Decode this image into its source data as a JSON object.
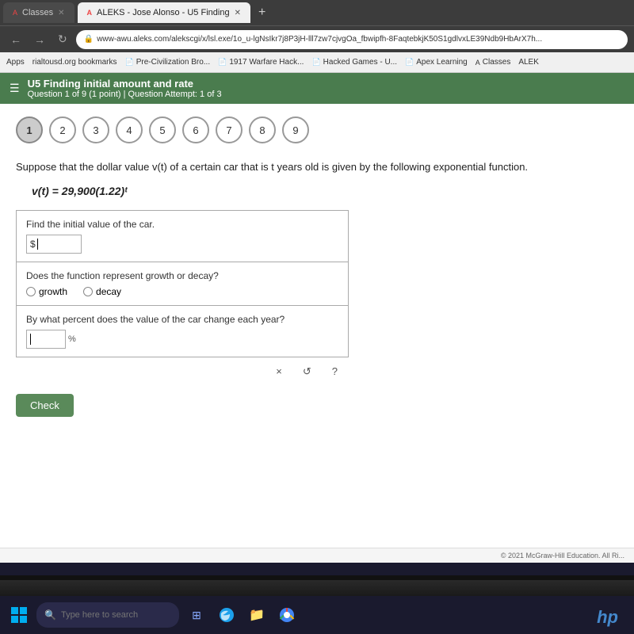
{
  "browser": {
    "tabs": [
      {
        "label": "Classes",
        "active": false
      },
      {
        "label": "ALEKS - Jose Alonso - U5 Finding",
        "active": true
      }
    ],
    "address": "www-awu.aleks.com/alekscgi/x/lsl.exe/1o_u-lgNsIkr7j8P3jH-lll7zw7cjvgOa_fbwipfh-8FaqtebkjK50S1gdlvxLE39Ndb9HbArX7h...",
    "bookmarks": [
      {
        "label": "Apps"
      },
      {
        "label": "rialtousd.org bookmarks"
      },
      {
        "label": "Pre-Civilization Bro..."
      },
      {
        "label": "1917 Warfare Hack..."
      },
      {
        "label": "Hacked Games - U..."
      },
      {
        "label": "Apex Learning"
      },
      {
        "label": "Classes"
      },
      {
        "label": "ALEK"
      }
    ]
  },
  "aleks": {
    "header": {
      "title": "U5 Finding initial amount and rate",
      "subtitle": "Question 1 of 9 (1 point)  |  Question Attempt: 1 of 3"
    },
    "question_numbers": [
      "1",
      "2",
      "3",
      "4",
      "5",
      "6",
      "7",
      "8",
      "9"
    ],
    "active_question": 0,
    "problem_text": "Suppose that the dollar value v(t) of a certain car that is t years old is given by the following exponential function.",
    "formula": "v(t) = 29,900(1.22)ᵗ",
    "questions": [
      {
        "label": "Find the initial value of the car.",
        "input_prefix": "$",
        "type": "text_input"
      },
      {
        "label": "Does the function represent growth or decay?",
        "type": "radio",
        "options": [
          "growth",
          "decay"
        ]
      },
      {
        "label": "By what percent does the value of the car change each year?",
        "type": "percent_input"
      }
    ],
    "action_buttons": [
      "×",
      "↺",
      "?"
    ],
    "check_button": "Check",
    "footer": "© 2021 McGraw-Hill Education. All Ri..."
  },
  "taskbar": {
    "search_placeholder": "Type here to search"
  }
}
